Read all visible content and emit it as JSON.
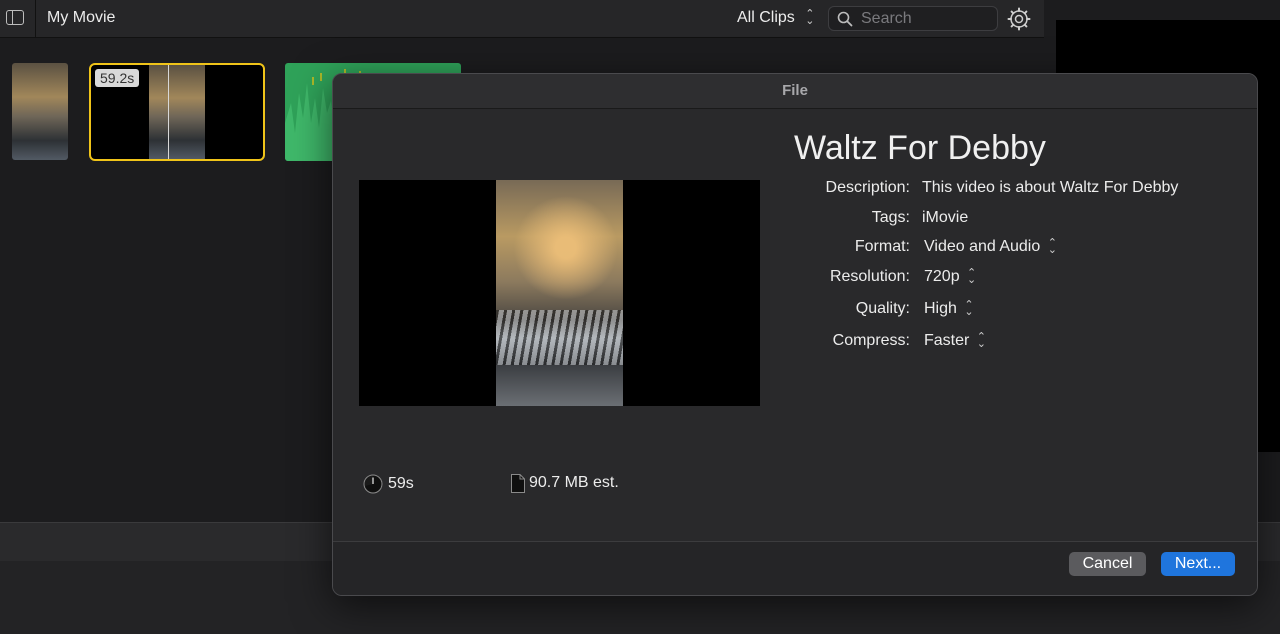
{
  "app": {
    "project_title": "My Movie",
    "clips_filter": "All Clips",
    "search_placeholder": "Search"
  },
  "browser": {
    "selected_clip_duration": "59.2s"
  },
  "dialog": {
    "title": "File",
    "movie_title": "Waltz For Debby",
    "properties": [
      {
        "label": "Description:",
        "value": "This video is about Waltz For Debby"
      },
      {
        "label": "Tags:",
        "value": "iMovie"
      },
      {
        "label": "Format:",
        "value": "Video and Audio"
      },
      {
        "label": "Resolution:",
        "value": "720p"
      },
      {
        "label": "Quality:",
        "value": "High"
      },
      {
        "label": "Compress:",
        "value": "Faster"
      }
    ],
    "duration": "59s",
    "size_estimate": "90.7 MB est.",
    "cancel_label": "Cancel",
    "next_label": "Next..."
  },
  "icons": {
    "sidebar": "sidebar-toggle-icon",
    "search": "search-icon",
    "settings": "gear-icon",
    "duration": "clock-icon",
    "size": "document-icon"
  },
  "colors": {
    "selection": "#f0c419",
    "primary_button": "#1f75dd",
    "audio_clip": "#2fa259"
  }
}
